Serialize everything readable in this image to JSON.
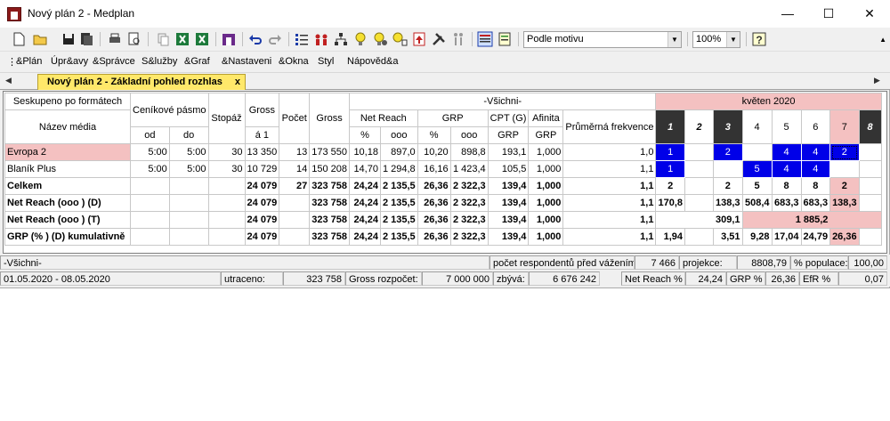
{
  "window": {
    "title": "Nový plán 2 - Medplan",
    "minimize": "—",
    "maximize": "☐",
    "close": "✕"
  },
  "toolbar": {
    "motif_select": "Podle motivu",
    "zoom_select": "100%"
  },
  "menu": [
    "&Plán",
    "Úpr&avy",
    "&Správce",
    "S&lužby",
    "&Graf",
    "&Nastaveni",
    "&Okna",
    "Styl",
    "Nápověd&a"
  ],
  "tab": {
    "label": "Nový plán 2 - Základní pohled rozhlas",
    "close": "x"
  },
  "table": {
    "group_header": "Seskupeno po formátech",
    "media_header": "Název média",
    "price_band": "Ceníkové pásmo",
    "from": "od",
    "to": "do",
    "stopaz": "Stopáž",
    "gross1_top": "Gross",
    "gross1_bottom": "á 1",
    "count": "Počet",
    "gross": "Gross",
    "all": "-Všichni-",
    "net_reach": "Net Reach",
    "grp": "GRP",
    "cpt": "CPT (G)",
    "afinita": "Afinita",
    "pct": "%",
    "ooo": "ooo",
    "grp_unit": "GRP",
    "avg_freq": "Průměrná frekvence",
    "month": "květen 2020",
    "days": [
      "1",
      "2",
      "3",
      "4",
      "5",
      "6",
      "7",
      "8"
    ],
    "rows": [
      {
        "name": "Evropa 2",
        "od": "5:00",
        "do": "5:00",
        "stopaz": "30",
        "gross1": "13 350",
        "pocet": "13",
        "gross": "173 550",
        "nr_pct": "10,18",
        "nr_ooo": "897,0",
        "grp_pct": "10,20",
        "grp_ooo": "898,8",
        "cpt": "193,1",
        "afinita": "1,000",
        "freq": "1,0",
        "d1": "1",
        "d3": "2",
        "d5": "4",
        "d6": "4",
        "d7": "2"
      },
      {
        "name": "Blaník Plus",
        "od": "5:00",
        "do": "5:00",
        "stopaz": "30",
        "gross1": "10 729",
        "pocet": "14",
        "gross": "150 208",
        "nr_pct": "14,70",
        "nr_ooo": "1 294,8",
        "grp_pct": "16,16",
        "grp_ooo": "1 423,4",
        "cpt": "105,5",
        "afinita": "1,000",
        "freq": "1,1",
        "d1": "1",
        "d4": "5",
        "d5": "4",
        "d6": "4"
      }
    ],
    "total": {
      "name": "Celkem",
      "gross1": "24 079",
      "pocet": "27",
      "gross": "323 758",
      "nr_pct": "24,24",
      "nr_ooo": "2 135,5",
      "grp_pct": "26,36",
      "grp_ooo": "2 322,3",
      "cpt": "139,4",
      "afinita": "1,000",
      "freq": "1,1",
      "d1": "2",
      "d3": "2",
      "d4": "5",
      "d5": "8",
      "d6": "8",
      "d7": "2"
    },
    "nr_d": {
      "name": "Net Reach (ooo ) (D)",
      "gross1": "24 079",
      "gross": "323 758",
      "nr_pct": "24,24",
      "nr_ooo": "2 135,5",
      "grp_pct": "26,36",
      "grp_ooo": "2 322,3",
      "cpt": "139,4",
      "afinita": "1,000",
      "freq": "1,1",
      "d1": "170,8",
      "d3": "138,3",
      "d4": "508,4",
      "d5": "683,3",
      "d6": "683,3",
      "d7": "138,3"
    },
    "nr_t": {
      "name": "Net Reach (ooo ) (T)",
      "gross1": "24 079",
      "gross": "323 758",
      "nr_pct": "24,24",
      "nr_ooo": "2 135,5",
      "grp_pct": "26,36",
      "grp_ooo": "2 322,3",
      "cpt": "139,4",
      "afinita": "1,000",
      "freq": "1,1",
      "week1": "309,1",
      "week2": "1 885,2"
    },
    "grp_cum": {
      "name": "GRP (% ) (D) kumulativně",
      "gross1": "24 079",
      "gross": "323 758",
      "nr_pct": "24,24",
      "nr_ooo": "2 135,5",
      "grp_pct": "26,36",
      "grp_ooo": "2 322,3",
      "cpt": "139,4",
      "afinita": "1,000",
      "freq": "1,1",
      "d1": "1,94",
      "d3": "3,51",
      "d4": "9,28",
      "d5": "17,04",
      "d6": "24,79",
      "d7": "26,36"
    }
  },
  "status1": {
    "target": "-Všichni-",
    "resp_label": "počet respondentů před vážením:",
    "resp_value": "7 466",
    "proj_label": "projekce:",
    "proj_value": "8808,79",
    "pop_label": "% populace:",
    "pop_value": "100,00"
  },
  "status2": {
    "dates": "01.05.2020 - 08.05.2020",
    "spent_label": "utraceno:",
    "spent_value": "323 758",
    "budget_label": "Gross rozpočet:",
    "budget_value": "7 000 000",
    "left_label": "zbývá:",
    "left_value": "6 676 242",
    "nr_label": "Net Reach %",
    "nr_value": "24,24",
    "grp_label": "GRP %",
    "grp_value": "26,36",
    "efr_label": "EfR %",
    "efr_value": "0,07"
  }
}
